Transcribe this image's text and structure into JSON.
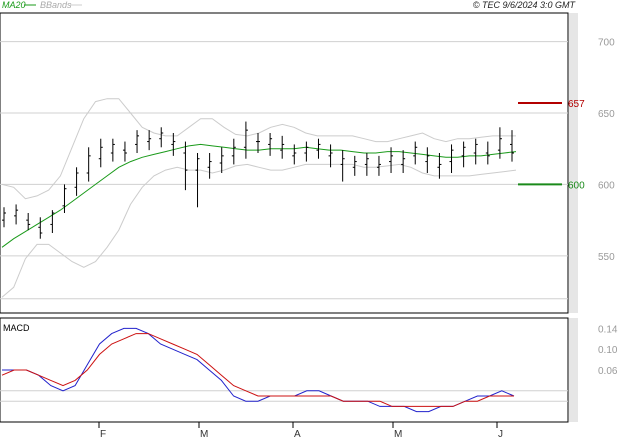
{
  "header": {
    "ma20_label": "MA20",
    "bbands_label": "BBands",
    "copyright": "© TEC 9/6/2024 3:0 GMT"
  },
  "macd_label": "MACD",
  "chart_data": [
    {
      "type": "candlestick",
      "y_ticks": [
        550,
        600,
        650,
        700
      ],
      "y_tick_labels": [
        "550",
        "600",
        "650",
        "700"
      ],
      "ylim": [
        510,
        720
      ],
      "x_months": [
        "F",
        "M",
        "A",
        "M",
        "J"
      ],
      "levels": [
        {
          "label": "657",
          "value": 657,
          "color": "#b30000"
        },
        {
          "label": "600",
          "value": 600,
          "color": "#1a8a1a"
        }
      ],
      "series": [
        {
          "name": "MA20",
          "color": "#1a9a1a",
          "values": [
            556,
            562,
            567,
            572,
            577,
            582,
            588,
            594,
            600,
            606,
            612,
            616,
            619,
            621,
            623,
            625,
            627,
            628,
            627,
            626,
            625,
            624,
            624,
            625,
            625,
            625,
            626,
            625,
            624,
            624,
            623,
            622,
            622,
            623,
            623,
            622,
            621,
            620,
            619,
            619,
            620,
            620,
            621,
            622,
            623
          ]
        },
        {
          "name": "BBands upper",
          "color": "#cccccc",
          "values": [
            600,
            598,
            590,
            592,
            596,
            606,
            626,
            646,
            658,
            660,
            660,
            650,
            640,
            636,
            634,
            634,
            640,
            646,
            646,
            640,
            635,
            634,
            636,
            640,
            642,
            640,
            636,
            634,
            634,
            634,
            634,
            632,
            630,
            630,
            632,
            634,
            636,
            632,
            630,
            632,
            632,
            633,
            634,
            634,
            634
          ]
        },
        {
          "name": "BBands lower",
          "color": "#cccccc",
          "values": [
            521,
            528,
            548,
            558,
            558,
            552,
            546,
            542,
            546,
            556,
            568,
            586,
            598,
            606,
            610,
            612,
            610,
            610,
            608,
            610,
            613,
            614,
            612,
            610,
            610,
            612,
            614,
            614,
            614,
            614,
            614,
            612,
            612,
            613,
            614,
            612,
            608,
            606,
            606,
            606,
            606,
            607,
            608,
            609,
            610
          ]
        },
        {
          "name": "OHLC",
          "values": [
            [
              575,
              584,
              570,
              580
            ],
            [
              578,
              586,
              572,
              582
            ],
            [
              575,
              580,
              568,
              572
            ],
            [
              570,
              577,
              562,
              566
            ],
            [
              572,
              582,
              566,
              580
            ],
            [
              585,
              600,
              580,
              597
            ],
            [
              598,
              612,
              592,
              608
            ],
            [
              608,
              626,
              602,
              620
            ],
            [
              618,
              632,
              612,
              626
            ],
            [
              622,
              632,
              616,
              628
            ],
            [
              624,
              630,
              616,
              622
            ],
            [
              628,
              638,
              622,
              634
            ],
            [
              630,
              638,
              624,
              632
            ],
            [
              632,
              640,
              626,
              636
            ],
            [
              628,
              636,
              620,
              630
            ],
            [
              622,
              630,
              596,
              610
            ],
            [
              610,
              622,
              584,
              618
            ],
            [
              612,
              622,
              604,
              616
            ],
            [
              615,
              626,
              608,
              620
            ],
            [
              620,
              632,
              614,
              626
            ],
            [
              626,
              644,
              618,
              638
            ],
            [
              630,
              636,
              622,
              630
            ],
            [
              628,
              636,
              620,
              632
            ],
            [
              624,
              634,
              618,
              628
            ],
            [
              620,
              628,
              614,
              622
            ],
            [
              622,
              630,
              616,
              626
            ],
            [
              624,
              632,
              618,
              628
            ],
            [
              620,
              628,
              612,
              622
            ],
            [
              614,
              624,
              602,
              618
            ],
            [
              612,
              620,
              606,
              616
            ],
            [
              614,
              622,
              606,
              618
            ],
            [
              612,
              620,
              606,
              614
            ],
            [
              616,
              626,
              608,
              620
            ],
            [
              614,
              624,
              608,
              618
            ],
            [
              620,
              630,
              614,
              626
            ],
            [
              616,
              626,
              608,
              620
            ],
            [
              612,
              622,
              604,
              614
            ],
            [
              616,
              628,
              608,
              624
            ],
            [
              620,
              630,
              612,
              626
            ],
            [
              622,
              632,
              614,
              628
            ],
            [
              622,
              630,
              614,
              620
            ],
            [
              624,
              640,
              618,
              632
            ],
            [
              628,
              638,
              616,
              622
            ]
          ]
        }
      ]
    },
    {
      "type": "line",
      "title": "MACD",
      "y_ticks": [
        0.06,
        0.1,
        0.14
      ],
      "y_tick_labels": [
        "0.06",
        "0.10",
        "0.14"
      ],
      "ylim": [
        -0.04,
        0.16
      ],
      "series": [
        {
          "name": "MACD",
          "color": "#2222cc",
          "values": [
            0.06,
            0.06,
            0.06,
            0.05,
            0.03,
            0.02,
            0.03,
            0.07,
            0.11,
            0.13,
            0.14,
            0.14,
            0.13,
            0.11,
            0.1,
            0.09,
            0.08,
            0.06,
            0.04,
            0.01,
            0.0,
            0.0,
            0.01,
            0.01,
            0.01,
            0.02,
            0.02,
            0.01,
            0.0,
            0.0,
            0.0,
            -0.01,
            -0.01,
            -0.01,
            -0.02,
            -0.02,
            -0.01,
            -0.01,
            0.0,
            0.01,
            0.01,
            0.02,
            0.01
          ]
        },
        {
          "name": "Signal",
          "color": "#cc1111",
          "values": [
            0.05,
            0.06,
            0.06,
            0.05,
            0.04,
            0.03,
            0.04,
            0.06,
            0.09,
            0.11,
            0.12,
            0.13,
            0.13,
            0.12,
            0.11,
            0.1,
            0.09,
            0.07,
            0.05,
            0.03,
            0.02,
            0.01,
            0.01,
            0.01,
            0.01,
            0.01,
            0.01,
            0.01,
            0.0,
            0.0,
            0.0,
            0.0,
            -0.01,
            -0.01,
            -0.01,
            -0.01,
            -0.01,
            -0.01,
            0.0,
            0.0,
            0.01,
            0.01,
            0.01
          ]
        }
      ]
    }
  ]
}
